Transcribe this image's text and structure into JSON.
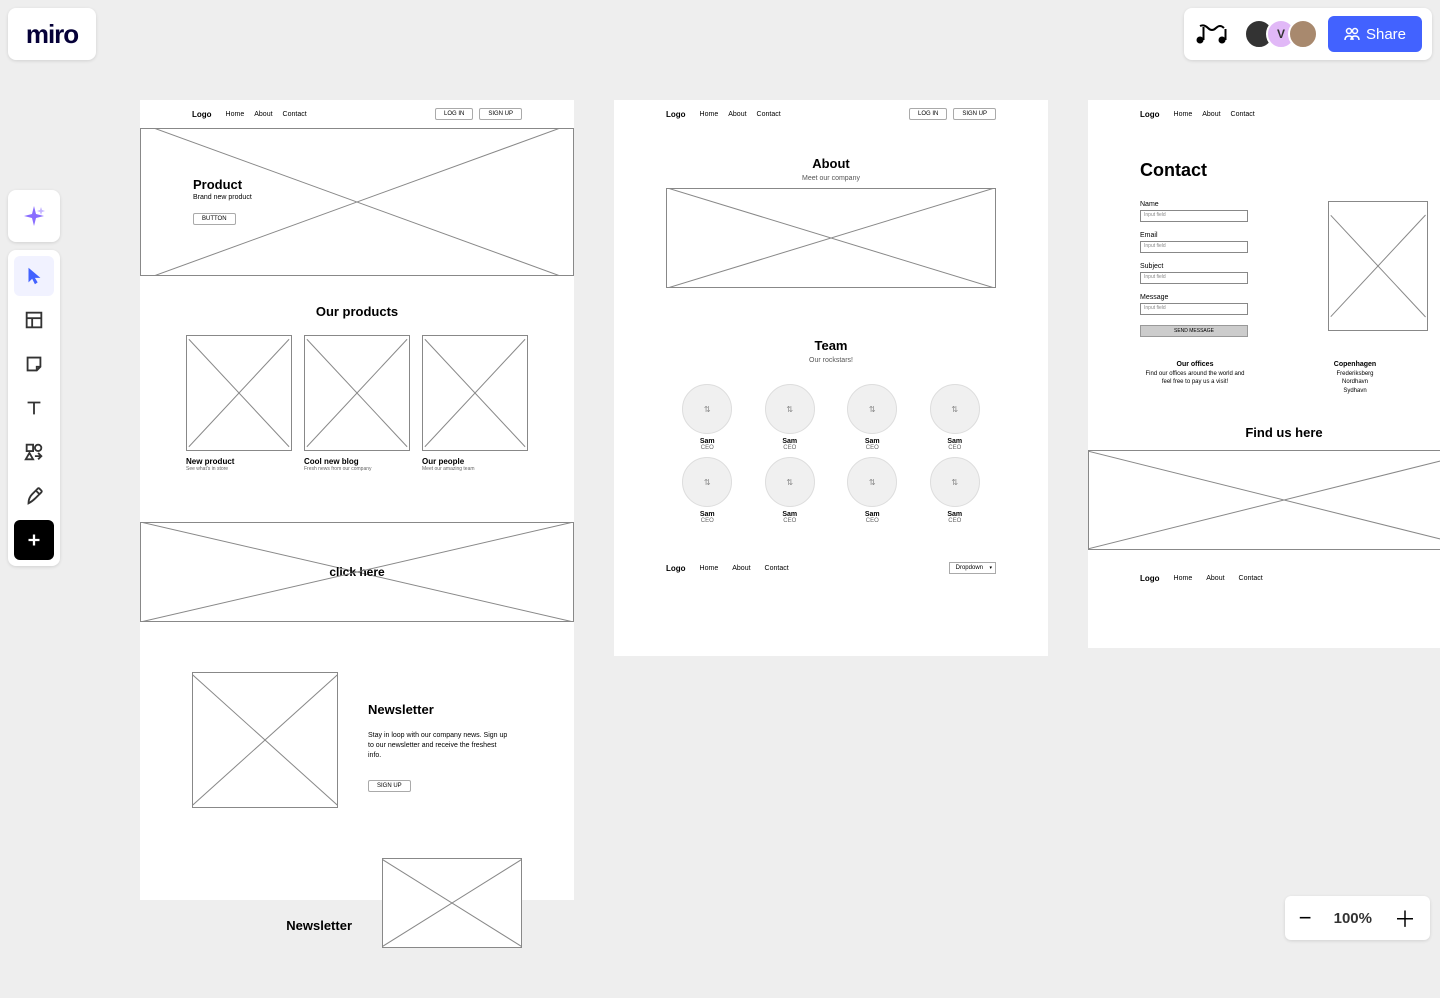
{
  "app": {
    "logo": "miro"
  },
  "collab": {
    "avatar2_initial": "V",
    "share_label": "Share"
  },
  "zoom": {
    "level": "100%"
  },
  "tools": {
    "ai": "ai-tool",
    "list": [
      "cursor",
      "frame",
      "sticky",
      "text",
      "shapes",
      "pen",
      "add"
    ]
  },
  "wf": {
    "nav": {
      "logo": "Logo",
      "home": "Home",
      "about": "About",
      "contact": "Contact"
    },
    "auth": {
      "login": "LOG IN",
      "signup": "SIGN UP"
    },
    "hero": {
      "title": "Product",
      "sub": "Brand new product",
      "btn": "BUTTON"
    },
    "products": {
      "title": "Our products",
      "items": [
        {
          "name": "New product",
          "sub": "See what's in store"
        },
        {
          "name": "Cool new blog",
          "sub": "Fresh news from our company"
        },
        {
          "name": "Our people",
          "sub": "Meet our amazing team"
        }
      ]
    },
    "banner": {
      "label": "click here"
    },
    "newsletter": {
      "title": "Newsletter",
      "body": "Stay in loop with our company news. Sign up to our newsletter and receive the freshest info.",
      "btn": "SIGN UP"
    },
    "newsletter2_title": "Newsletter",
    "about": {
      "title": "About",
      "sub": "Meet our company"
    },
    "team": {
      "title": "Team",
      "sub": "Our rockstars!",
      "members": [
        {
          "name": "Sam",
          "role": "CEO"
        },
        {
          "name": "Sam",
          "role": "CEO"
        },
        {
          "name": "Sam",
          "role": "CEO"
        },
        {
          "name": "Sam",
          "role": "CEO"
        },
        {
          "name": "Sam",
          "role": "CEO"
        },
        {
          "name": "Sam",
          "role": "CEO"
        },
        {
          "name": "Sam",
          "role": "CEO"
        },
        {
          "name": "Sam",
          "role": "CEO"
        }
      ]
    },
    "footer": {
      "dropdown": "Dropdown"
    },
    "contact": {
      "title": "Contact",
      "fields": {
        "name": "Name",
        "email": "Email",
        "subject": "Subject",
        "message": "Message",
        "placeholder": "Input field"
      },
      "send": "SEND MESSAGE",
      "offices": {
        "title": "Our offices",
        "sub": "Find our offices around the world and feel free to pay us a visit!",
        "copenhagen": {
          "title": "Copenhagen",
          "lines": "Frederiksberg\nNordhavn\nSydhavn"
        }
      },
      "findus": "Find us here"
    }
  }
}
